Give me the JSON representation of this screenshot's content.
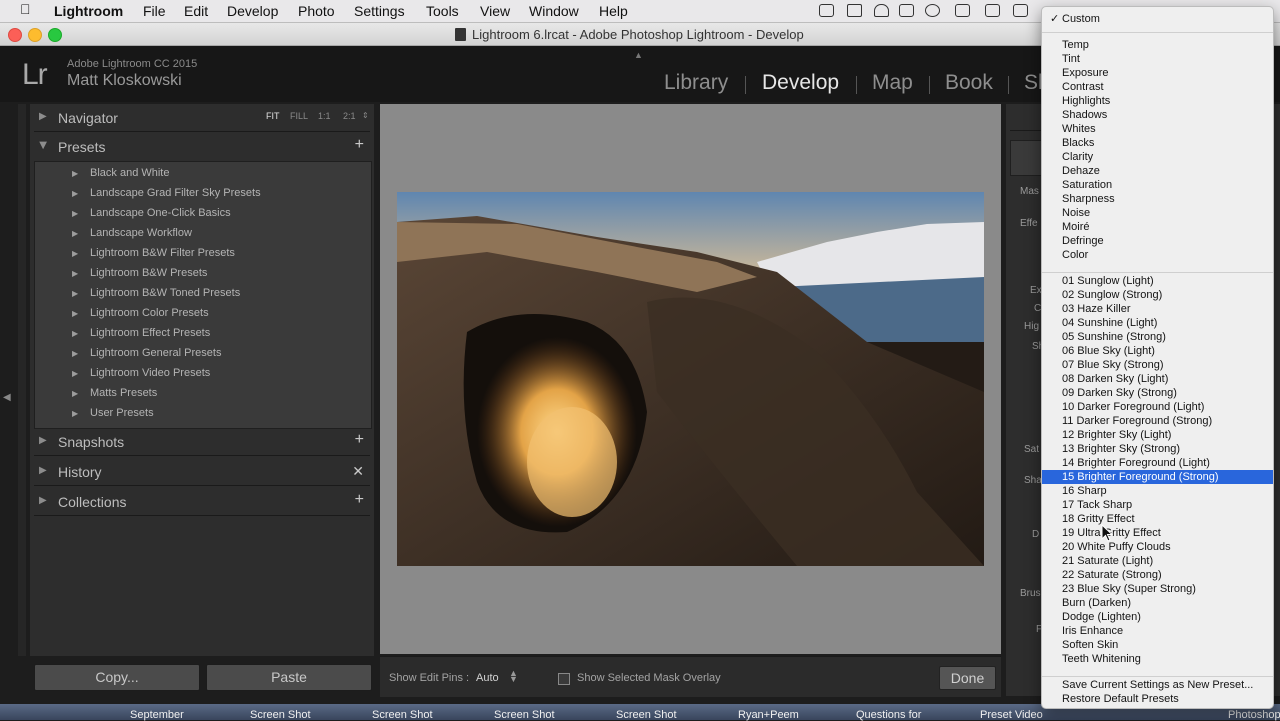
{
  "menubar": {
    "app_name": "Lightroom",
    "items": [
      "File",
      "Edit",
      "Develop",
      "Photo",
      "Settings",
      "Tools",
      "View",
      "Window",
      "Help"
    ]
  },
  "window": {
    "title": "Lightroom 6.lrcat - Adobe Photoshop Lightroom - Develop"
  },
  "identity": {
    "logo": "Lr",
    "version": "Adobe Lightroom CC 2015",
    "user": "Matt Kloskowski",
    "modules": [
      "Library",
      "Develop",
      "Map",
      "Book",
      "Sl"
    ],
    "active_module": "Develop"
  },
  "left_panel": {
    "navigator": {
      "title": "Navigator",
      "zoom": [
        "FIT",
        "FILL",
        "1:1",
        "2:1"
      ]
    },
    "presets": {
      "title": "Presets",
      "folders": [
        "Black and White",
        "Landscape Grad Filter Sky Presets",
        "Landscape One-Click Basics",
        "Landscape Workflow",
        "Lightroom B&W Filter Presets",
        "Lightroom B&W Presets",
        "Lightroom B&W Toned Presets",
        "Lightroom Color Presets",
        "Lightroom Effect Presets",
        "Lightroom General Presets",
        "Lightroom Video Presets",
        "Matts Presets",
        "User Presets"
      ]
    },
    "snapshots": "Snapshots",
    "history": "History",
    "collections": "Collections",
    "copy_button": "Copy...",
    "paste_button": "Paste"
  },
  "toolbar": {
    "edit_pins_label": "Show Edit Pins :",
    "edit_pins_value": "Auto",
    "mask_overlay_label": "Show Selected Mask Overlay",
    "mask_overlay_checked": false,
    "done_label": "Done"
  },
  "right_panel_visible_labels": [
    "Mas",
    "Effe",
    "Ex",
    "C",
    "Hig",
    "Sh",
    "Sat",
    "Sha",
    "D",
    "Brus",
    "F"
  ],
  "popup_menu": {
    "checked_item": "Custom",
    "group_effects": [
      "Temp",
      "Tint",
      "Exposure",
      "Contrast",
      "Highlights",
      "Shadows",
      "Whites",
      "Blacks",
      "Clarity",
      "Dehaze",
      "Saturation",
      "Sharpness",
      "Noise",
      "Moiré",
      "Defringe",
      "Color"
    ],
    "group_presets": [
      "01 Sunglow (Light)",
      "02 Sunglow (Strong)",
      "03 Haze Killer",
      "04 Sunshine (Light)",
      "05 Sunshine (Strong)",
      "06 Blue Sky (Light)",
      "07 Blue Sky (Strong)",
      "08 Darken Sky (Light)",
      "09 Darken Sky (Strong)",
      "10 Darker Foreground (Light)",
      "11 Darker Foreground (Strong)",
      "12 Brighter Sky (Light)",
      "13 Brighter Sky (Strong)",
      "14 Brighter Foreground (Light)",
      "15 Brighter Foreground (Strong)",
      "16 Sharp",
      "17 Tack Sharp",
      "18 Gritty Effect",
      "19 Ultra Gritty Effect",
      "20 White Puffy Clouds",
      "21 Saturate (Light)",
      "22 Saturate (Strong)",
      "23 Blue Sky (Super Strong)",
      "Burn (Darken)",
      "Dodge (Lighten)",
      "Iris Enhance",
      "Soften Skin",
      "Teeth Whitening"
    ],
    "highlighted_item": "15 Brighter Foreground (Strong)",
    "group_actions": [
      "Save Current Settings as New Preset...",
      "Restore Default Presets"
    ]
  },
  "dock_labels": [
    "September",
    "Screen Shot",
    "Screen Shot",
    "Screen Shot",
    "Screen Shot",
    "Ryan+Peem",
    "Questions for",
    "Preset Video",
    "Photoshop"
  ],
  "colors": {
    "highlight": "#2966dc",
    "panel": "#2d2d2d",
    "canvas": "#8a8a8a"
  }
}
